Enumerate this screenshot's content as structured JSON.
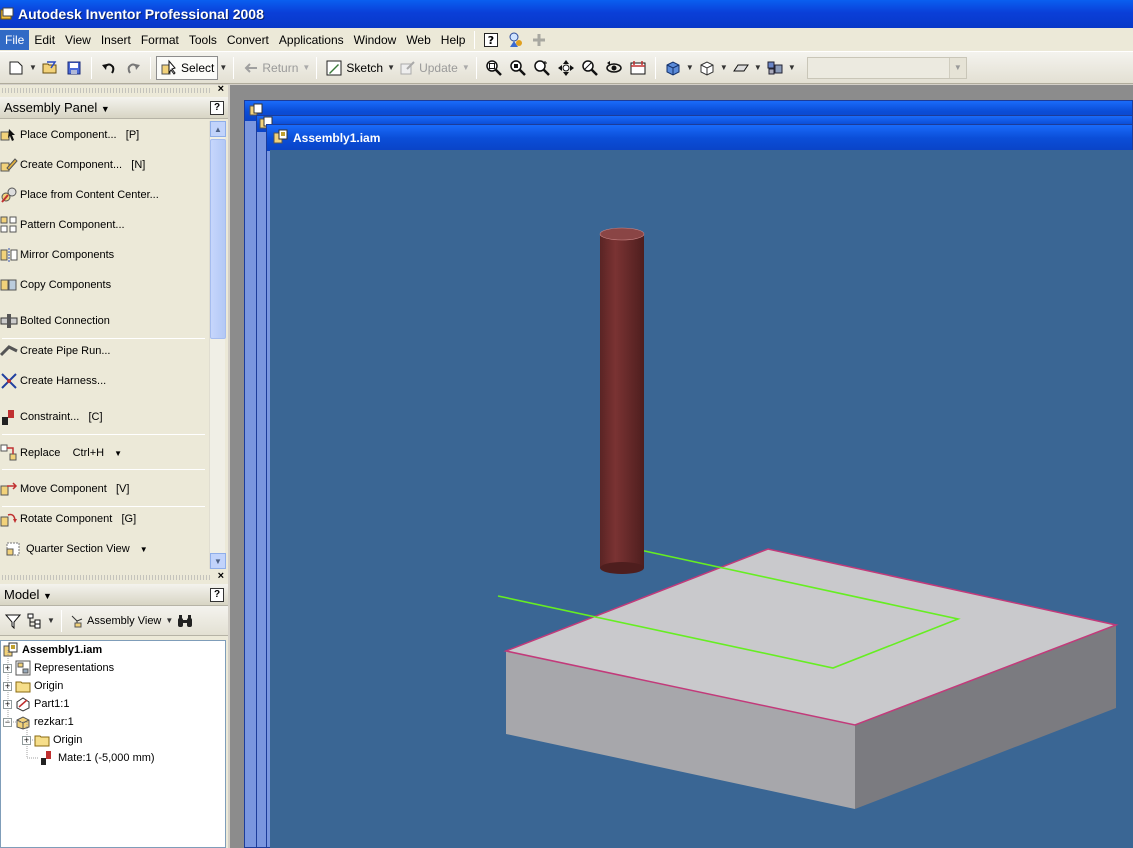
{
  "window": {
    "title": "Autodesk Inventor Professional 2008"
  },
  "menu": {
    "items": [
      {
        "label": "File",
        "active": true
      },
      {
        "label": "Edit"
      },
      {
        "label": "View"
      },
      {
        "label": "Insert"
      },
      {
        "label": "Format"
      },
      {
        "label": "Tools"
      },
      {
        "label": "Convert"
      },
      {
        "label": "Applications"
      },
      {
        "label": "Window"
      },
      {
        "label": "Web"
      },
      {
        "label": "Help"
      }
    ]
  },
  "toolbar": {
    "select_label": "Select",
    "return_label": "Return",
    "sketch_label": "Sketch",
    "update_label": "Update"
  },
  "assembly_panel": {
    "title": "Assembly Panel",
    "commands": [
      {
        "label": "Place Component...   [P]",
        "icon": "place-component-icon"
      },
      {
        "label": "Create Component...   [N]",
        "icon": "create-component-icon"
      },
      {
        "label": "Place from Content Center...",
        "icon": "content-center-icon"
      },
      {
        "label": "Pattern Component...",
        "icon": "pattern-component-icon"
      },
      {
        "label": "Mirror Components",
        "icon": "mirror-components-icon"
      },
      {
        "label": "Copy Components",
        "icon": "copy-components-icon"
      },
      {
        "label": "Bolted Connection",
        "icon": "bolted-connection-icon"
      },
      {
        "label": "Create Pipe Run...",
        "icon": "pipe-run-icon"
      },
      {
        "label": "Create Harness...",
        "icon": "harness-icon"
      },
      {
        "label": "Constraint...   [C]",
        "icon": "constraint-icon"
      },
      {
        "label": "Replace    Ctrl+H",
        "icon": "replace-icon"
      },
      {
        "label": "Move Component   [V]",
        "icon": "move-component-icon"
      },
      {
        "label": "Rotate Component   [G]",
        "icon": "rotate-component-icon"
      },
      {
        "label": "Quarter Section View",
        "icon": "section-view-icon"
      }
    ]
  },
  "model_browser": {
    "title": "Model",
    "view_label": "Assembly View",
    "tree": [
      {
        "label": "Assembly1.iam"
      },
      {
        "label": "Representations"
      },
      {
        "label": "Origin"
      },
      {
        "label": "Part1:1"
      },
      {
        "label": "rezkar:1"
      },
      {
        "label": "Origin"
      },
      {
        "label": "Mate:1 (-5,000 mm)"
      }
    ]
  },
  "document": {
    "title": "Assembly1.iam"
  },
  "colors": {
    "viewport_bg": "#3a6694",
    "cylinder": "#6e2e2e",
    "block_top": "#c9c9cc",
    "sketch_line": "#66ee22",
    "edge_highlight": "#c23a7a"
  }
}
